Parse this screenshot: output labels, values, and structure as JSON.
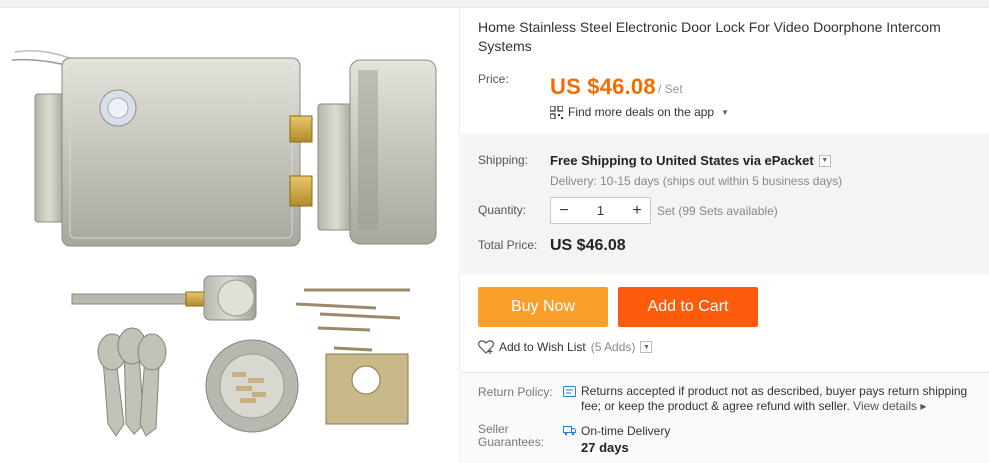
{
  "product": {
    "title": "Home Stainless Steel Electronic Door Lock For Video Doorphone Intercom Systems",
    "image_alt": "Electronic door lock with keys, cylinder, screws and strike plate"
  },
  "price": {
    "label": "Price:",
    "value": "US $46.08",
    "unit": "/ Set",
    "deals_text": "Find more deals on the app"
  },
  "shipping": {
    "label": "Shipping:",
    "method": "Free Shipping to United States via ePacket",
    "delivery": "Delivery: 10-15 days (ships out within 5 business days)"
  },
  "quantity": {
    "label": "Quantity:",
    "minus": "−",
    "value": "1",
    "plus": "+",
    "availability": "Set (99 Sets available)"
  },
  "total": {
    "label": "Total Price:",
    "value": "US $46.08"
  },
  "actions": {
    "buy_now": "Buy Now",
    "add_to_cart": "Add to Cart",
    "wishlist": "Add to Wish List",
    "wishlist_count": "(5 Adds)"
  },
  "policy": {
    "return_label": "Return Policy:",
    "return_text": "Returns accepted if product not as described, buyer pays return shipping fee; or keep the product & agree refund with seller.",
    "view_details": "View details ▸",
    "seller_label": "Seller Guarantees:",
    "ontime": "On-time Delivery",
    "days": "27 days"
  },
  "colors": {
    "price_orange": "#f46c00",
    "buy_now": "#f8a02a",
    "add_to_cart": "#fe5b0d",
    "icon_blue": "#2a7fd4"
  }
}
